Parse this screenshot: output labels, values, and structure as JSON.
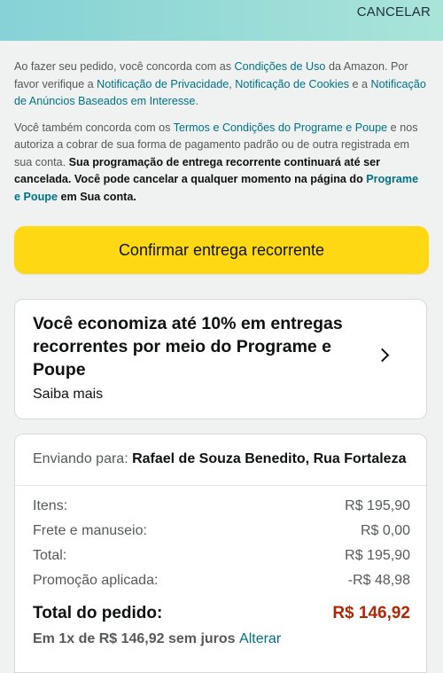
{
  "header": {
    "cancel_label": "CANCELAR"
  },
  "legal": {
    "p1": {
      "t1": "Ao fazer seu pedido, você concorda com as ",
      "link_terms": "Condições de Uso",
      "t2": " da Amazon. Por favor verifique a ",
      "link_privacy": "Notificação de Privacidade",
      "t3": ", ",
      "link_cookies": "Notificação de Cookies",
      "t4": " e a ",
      "link_ads": "Notificação de Anúncios Baseados em Interesse",
      "t5": "."
    },
    "p2": {
      "t1": "Você também concorda com os ",
      "link_program_terms": "Termos e Condições do Programe e Poupe",
      "t2": " e nos autoriza a cobrar de sua forma de pagamento padrão ou de outra registrada em sua conta. ",
      "bold1": "Sua programação de entrega recorrente continuará até ser cancelada. Você pode cancelar a qualquer momento na página do ",
      "bold_link": "Programe e Poupe",
      "bold2": " em Sua conta."
    }
  },
  "confirm_button": "Confirmar entrega recorrente",
  "promo": {
    "title": "Você economiza até 10% em entregas recorrentes por meio do Programe e Poupe",
    "subtitle": "Saiba mais"
  },
  "summary": {
    "shipping_label": "Enviando para: ",
    "shipping_address": "Rafael de Souza Benedito, Rua Fortaleza",
    "rows": [
      {
        "label": "Itens:",
        "value": "R$ 195,90"
      },
      {
        "label": "Frete e manuseio:",
        "value": "R$ 0,00"
      },
      {
        "label": "Total:",
        "value": "R$ 195,90"
      },
      {
        "label": "Promoção aplicada:",
        "value": "-R$ 48,98"
      }
    ],
    "order_total_label": "Total do pedido:",
    "order_total_value": "R$ 146,92",
    "installment_text": "Em 1x de R$ 146,92 sem juros ",
    "installment_link": "Alterar"
  }
}
